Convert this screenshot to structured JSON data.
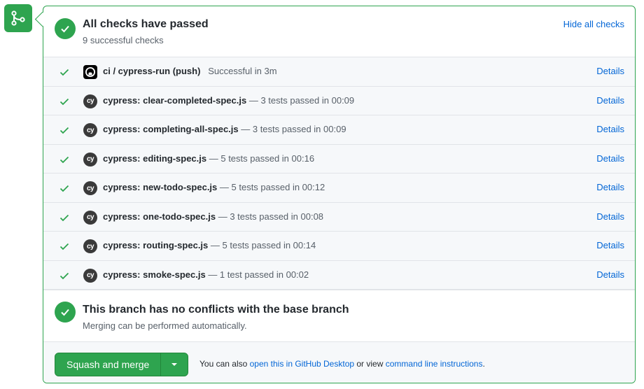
{
  "header": {
    "title": "All checks have passed",
    "subtitle": "9 successful checks",
    "hide_link": "Hide all checks"
  },
  "checks": [
    {
      "avatar": "github-icon",
      "name": "ci / cypress-run (push)",
      "desc": "Successful in 3m",
      "details": "Details"
    },
    {
      "avatar": "cy",
      "name": "cypress: clear-completed-spec.js",
      "desc": " — 3 tests passed in 00:09",
      "details": "Details"
    },
    {
      "avatar": "cy",
      "name": "cypress: completing-all-spec.js",
      "desc": " — 3 tests passed in 00:09",
      "details": "Details"
    },
    {
      "avatar": "cy",
      "name": "cypress: editing-spec.js",
      "desc": " — 5 tests passed in 00:16",
      "details": "Details"
    },
    {
      "avatar": "cy",
      "name": "cypress: new-todo-spec.js",
      "desc": " — 5 tests passed in 00:12",
      "details": "Details"
    },
    {
      "avatar": "cy",
      "name": "cypress: one-todo-spec.js",
      "desc": " — 3 tests passed in 00:08",
      "details": "Details"
    },
    {
      "avatar": "cy",
      "name": "cypress: routing-spec.js",
      "desc": " — 5 tests passed in 00:14",
      "details": "Details"
    },
    {
      "avatar": "cy",
      "name": "cypress: smoke-spec.js",
      "desc": " — 1 test passed in 00:02",
      "details": "Details"
    }
  ],
  "conflict": {
    "title": "This branch has no conflicts with the base branch",
    "subtitle": "Merging can be performed automatically."
  },
  "merge": {
    "button_label": "Squash and merge",
    "note_prefix": "You can also ",
    "desktop_link": "open this in GitHub Desktop",
    "note_middle": " or view ",
    "cli_link": "command line instructions",
    "note_suffix": "."
  },
  "colors": {
    "success": "#2ea44f",
    "link": "#0366d6",
    "muted": "#586069"
  }
}
